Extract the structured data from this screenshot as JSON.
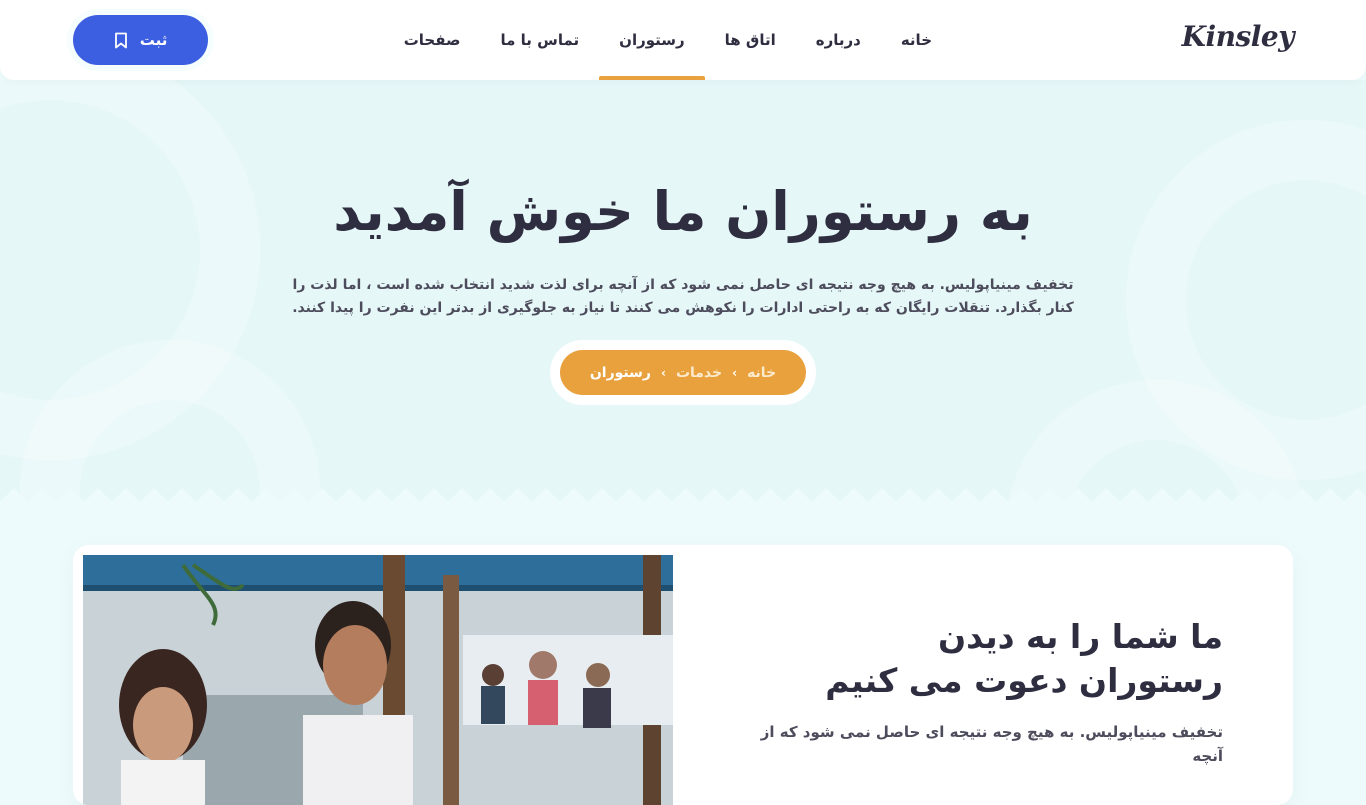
{
  "header": {
    "logo": "Kinsley",
    "nav": [
      {
        "label": "خانه",
        "active": false
      },
      {
        "label": "درباره",
        "active": false
      },
      {
        "label": "اتاق ها",
        "active": false
      },
      {
        "label": "رستوران",
        "active": true
      },
      {
        "label": "تماس با ما",
        "active": false
      },
      {
        "label": "صفحات",
        "active": false
      }
    ],
    "cta_label": "ثبت",
    "cta_icon": "bookmark-icon"
  },
  "hero": {
    "title": "به رستوران ما خوش آمدید",
    "description": "تخفیف مینیاپولیس. به هیچ وجه نتیجه ای حاصل نمی شود که از آنچه برای لذت شدید انتخاب شده است ، اما لذت را کنار بگذارد. تنقلات رایگان که به راحتی ادارات را نکوهش می کنند تا نیاز به جلوگیری از بدتر این نفرت را پیدا کنند.",
    "breadcrumb": {
      "home": "خانه",
      "services": "خدمات",
      "current": "رستوران",
      "separator": "›"
    }
  },
  "intro": {
    "title": "ما شما را به دیدن رستوران دعوت می کنیم",
    "text": "تخفیف مینیاپولیس. به هیچ وجه نتیجه ای حاصل نمی شود که از آنچه"
  },
  "colors": {
    "accent": "#e8a13c",
    "primary": "#3b5fe0",
    "hero_bg": "#e6f7f8",
    "text_dark": "#2f2e41"
  }
}
